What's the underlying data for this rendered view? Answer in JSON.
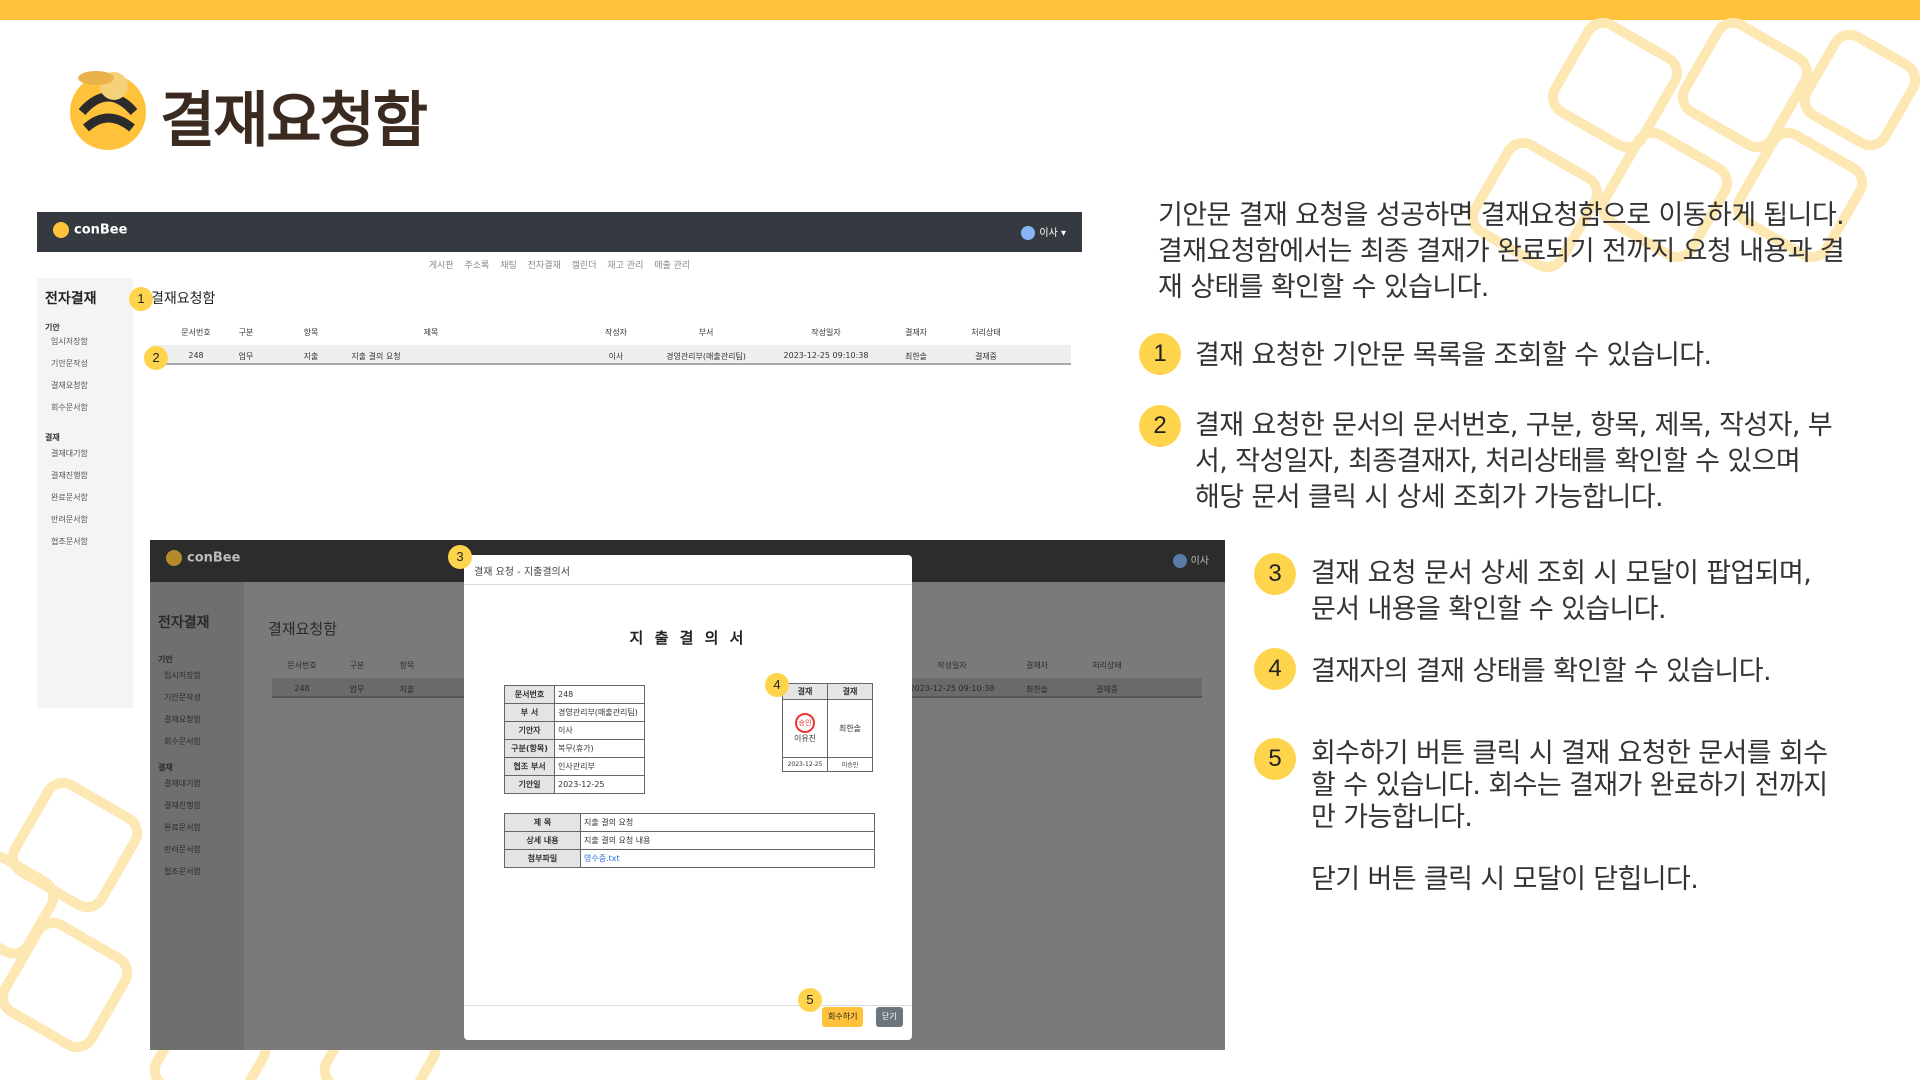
{
  "slide_title": "결재요청함",
  "colors": {
    "accent": "#ffc23a",
    "badge": "#ffd44d",
    "navbar": "#343a40"
  },
  "app": {
    "brand": "conBee",
    "user": "이사",
    "menu": [
      "게시판",
      "주소록",
      "채팅",
      "전자결재",
      "캘린더",
      "재고 관리",
      "매출 관리"
    ],
    "sidebar_title": "전자결재",
    "sidebar_sections": [
      {
        "title": "기안",
        "items": [
          "임시저장함",
          "기안문작성",
          "결재요청함",
          "회수문서함"
        ]
      },
      {
        "title": "결재",
        "items": [
          "결재대기함",
          "결재진행함",
          "완료문서함",
          "반려문서함",
          "협조문서함"
        ]
      }
    ],
    "page_title": "결재요청함",
    "table": {
      "headers": [
        "문서번호",
        "구분",
        "항목",
        "제목",
        "작성자",
        "부서",
        "작성일자",
        "결재자",
        "처리상태"
      ],
      "rows": [
        [
          "248",
          "업무",
          "지출",
          "지출 결의 요청",
          "이사",
          "경영관리부(매출관리팀)",
          "2023-12-25 09:10:38",
          "최한솔",
          "결재중"
        ]
      ]
    }
  },
  "modal": {
    "header": "결재 요청 - 지출결의서",
    "doc_title": "지 출 결 의 서",
    "info": [
      {
        "k": "문서번호",
        "v": "248"
      },
      {
        "k": "부 서",
        "v": "경영관리부(매출관리팀)"
      },
      {
        "k": "기안자",
        "v": "이사"
      },
      {
        "k": "구분(항목)",
        "v": "복무(휴가)"
      },
      {
        "k": "협조 부서",
        "v": "인사관리부"
      },
      {
        "k": "기안일",
        "v": "2023-12-25"
      }
    ],
    "approval": {
      "label": "결재",
      "col2": "결재",
      "stamp": "승인",
      "approver1": "이유진",
      "approver2": "최한솔",
      "date1": "2023-12-25",
      "status2": "미승인"
    },
    "details": [
      {
        "k": "제 목",
        "v": "지출 결의 요청"
      },
      {
        "k": "상세 내용",
        "v": "지출 결의 요청 내용"
      },
      {
        "k": "첨부파일",
        "v": "영수증.txt"
      }
    ],
    "recall_button": "회수하기",
    "close_button": "닫기"
  },
  "badges": [
    "1",
    "2",
    "3",
    "4",
    "5"
  ],
  "description": {
    "intro": [
      "기안문 결재 요청을 성공하면 결재요청함으로 이동하게 됩니다.",
      "결재요청함에서는 최종 결재가 완료되기 전까지 요청 내용과 결",
      "재 상태를 확인할 수 있습니다."
    ],
    "p1": [
      "결재 요청한 기안문 목록을 조회할 수 있습니다."
    ],
    "p2": [
      "결재 요청한 문서의 문서번호, 구분, 항목, 제목, 작성자, 부",
      "서, 작성일자, 최종결재자, 처리상태를 확인할 수 있으며",
      "해당 문서 클릭 시 상세 조회가 가능합니다."
    ],
    "p3": [
      "결재 요청 문서 상세 조회 시 모달이 팝업되며,",
      "문서 내용을 확인할 수 있습니다."
    ],
    "p4": [
      "결재자의 결재 상태를 확인할 수 있습니다."
    ],
    "p5": [
      "회수하기 버튼 클릭 시 결재 요청한 문서를 회수",
      "할 수 있습니다. 회수는 결재가 완료하기 전까지",
      "만 가능합니다."
    ],
    "p6": [
      "닫기 버튼 클릭 시 모달이 닫힙니다."
    ]
  }
}
